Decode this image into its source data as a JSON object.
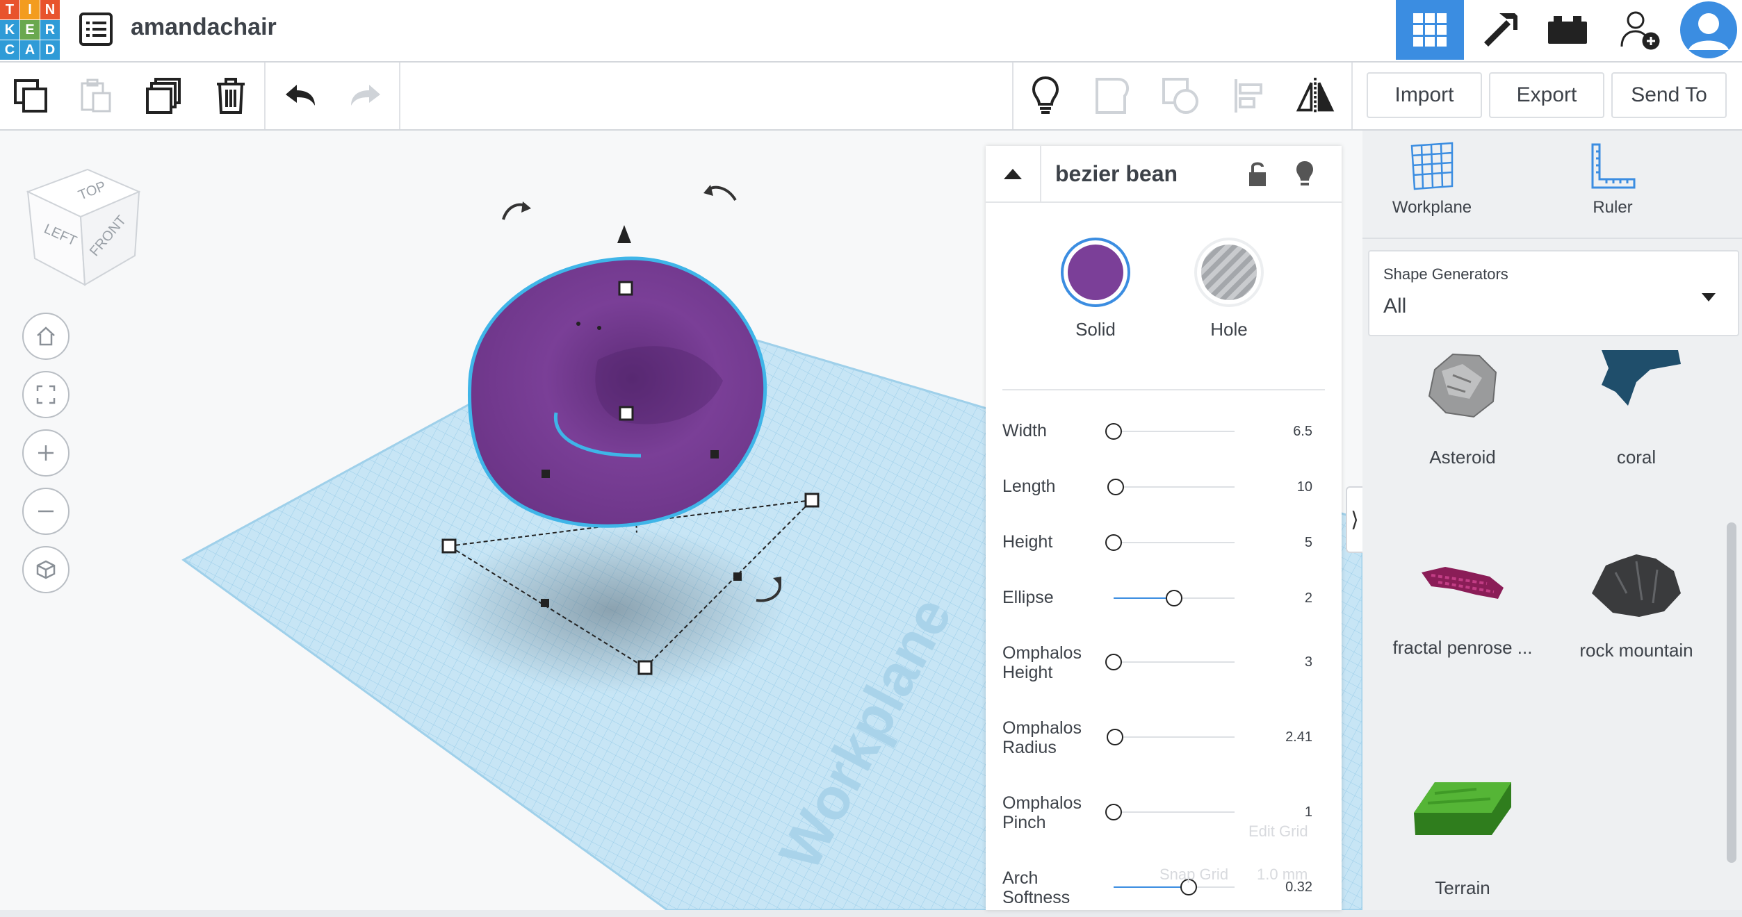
{
  "app": {
    "logo_letters": [
      "T",
      "I",
      "N",
      "K",
      "E",
      "R",
      "C",
      "A",
      "D"
    ],
    "document_title": "amandachair"
  },
  "top_nav": {
    "icons": [
      "grid-view-icon",
      "pickaxe-icon",
      "bricks-icon",
      "invite-user-icon",
      "profile-avatar-icon"
    ],
    "active": "grid-view-icon"
  },
  "toolbar": {
    "left_icons": [
      "copy-icon",
      "paste-icon",
      "duplicate-icon",
      "delete-icon",
      "undo-icon",
      "redo-icon"
    ],
    "right_icons": [
      "lightbulb-icon",
      "group-icon",
      "ungroup-icon",
      "align-icon",
      "mirror-icon"
    ],
    "import_label": "Import",
    "export_label": "Export",
    "send_to_label": "Send To"
  },
  "viewcube": {
    "top": "TOP",
    "left": "LEFT",
    "front": "FRONT"
  },
  "workplane_watermark": "Workplane",
  "inspector": {
    "shape_name": "bezier bean",
    "solid_label": "Solid",
    "hole_label": "Hole",
    "solid_color": "#7b3f98",
    "properties": [
      {
        "name": "Width",
        "value": "6.5",
        "level": 0.0
      },
      {
        "name": "Length",
        "value": "10",
        "level": 0.02
      },
      {
        "name": "Height",
        "value": "5",
        "level": 0.0
      },
      {
        "name": "Ellipse",
        "value": "2",
        "level": 0.5
      },
      {
        "name": "Omphalos Height",
        "value": "3",
        "level": 0.0
      },
      {
        "name": "Omphalos Radius",
        "value": "2.41",
        "level": 0.01
      },
      {
        "name": "Omphalos Pinch",
        "value": "1",
        "level": 0.0
      },
      {
        "name": "Arch Softness",
        "value": "0.32",
        "level": 0.62
      }
    ]
  },
  "grid_controls": {
    "edit_grid": "Edit Grid",
    "snap_grid": "Snap Grid",
    "snap_value": "1.0 mm"
  },
  "right_panel": {
    "workplane_label": "Workplane",
    "ruler_label": "Ruler",
    "shape_generators_title": "Shape Generators",
    "shape_generators_value": "All",
    "items": [
      {
        "label": "Asteroid",
        "icon": "asteroid-icon"
      },
      {
        "label": "coral",
        "icon": "coral-icon"
      },
      {
        "label": "fractal penrose ...",
        "icon": "fractal-penrose-icon"
      },
      {
        "label": "rock mountain",
        "icon": "rock-mountain-icon"
      },
      {
        "label": "Terrain",
        "icon": "terrain-icon"
      }
    ]
  }
}
